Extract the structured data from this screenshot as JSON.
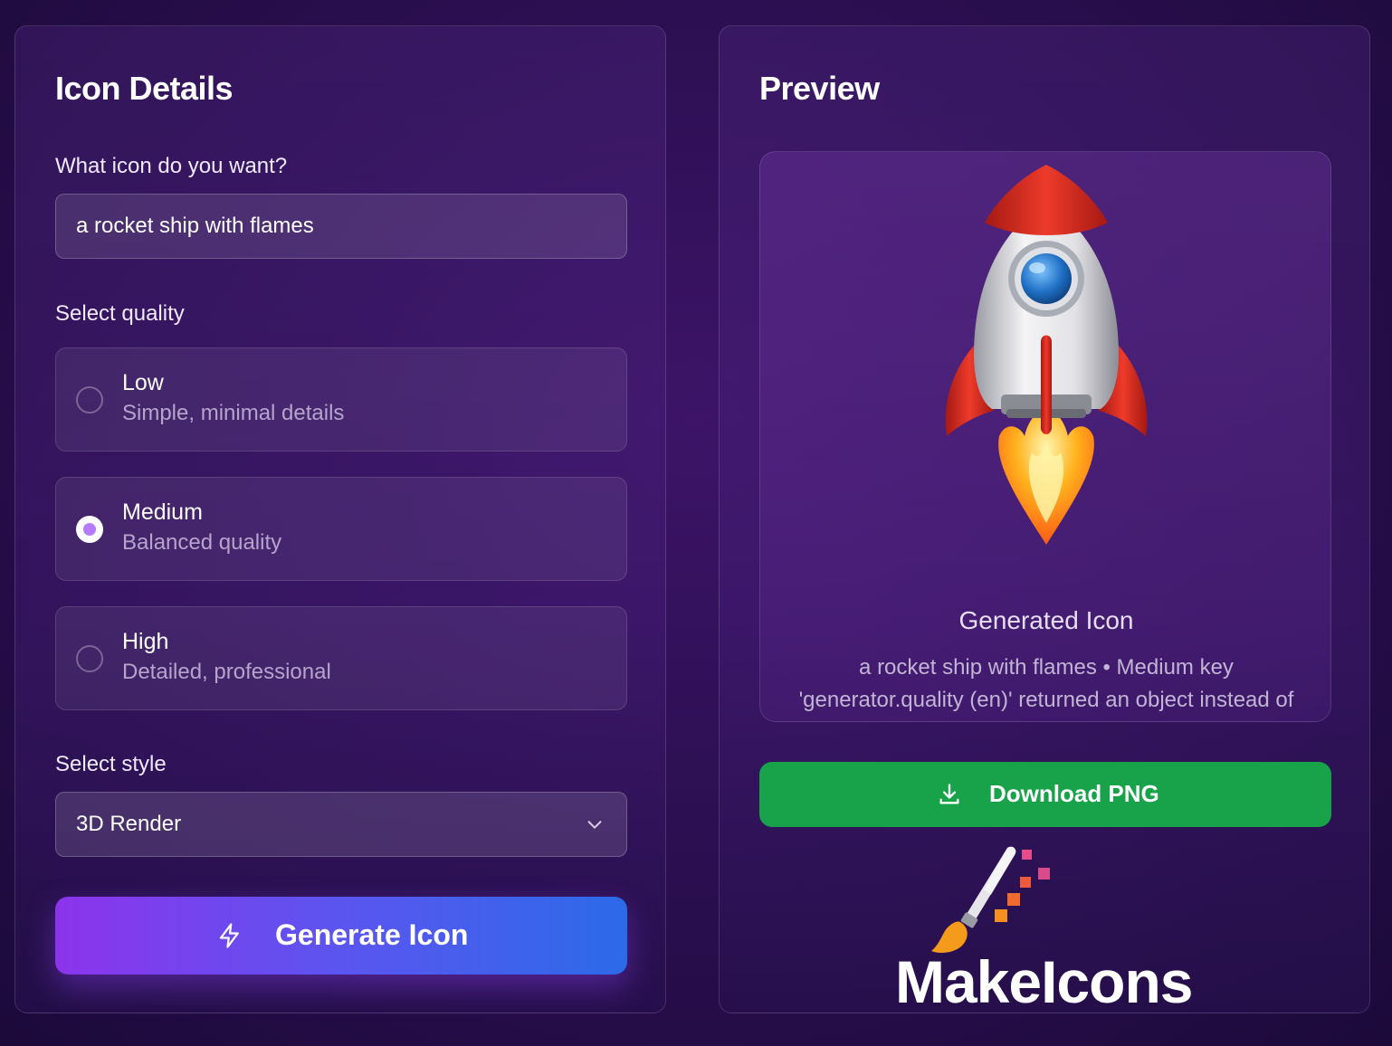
{
  "form": {
    "title": "Icon Details",
    "prompt_label": "What icon do you want?",
    "prompt_value": "a rocket ship with flames",
    "quality_label": "Select quality",
    "quality_options": [
      {
        "title": "Low",
        "desc": "Simple, minimal details",
        "selected": false
      },
      {
        "title": "Medium",
        "desc": "Balanced quality",
        "selected": true
      },
      {
        "title": "High",
        "desc": "Detailed, professional",
        "selected": false
      }
    ],
    "style_label": "Select style",
    "style_value": "3D Render",
    "generate_label": "Generate Icon"
  },
  "preview": {
    "title": "Preview",
    "generated_title": "Generated Icon",
    "caption_line1": "a rocket ship with flames • Medium key",
    "caption_line2": "'generator.quality (en)' returned an object instead of",
    "download_label": "Download PNG"
  },
  "brand": {
    "name": "MakeIcons"
  },
  "icons": {
    "generate": "lightning-icon",
    "download": "download-icon",
    "select": "chevron-down-icon"
  },
  "colors": {
    "accent_purple": "#b57bff",
    "generate_gradient_start": "#8c34ec",
    "generate_gradient_end": "#2c6ae9",
    "download_green": "#18a34a"
  }
}
